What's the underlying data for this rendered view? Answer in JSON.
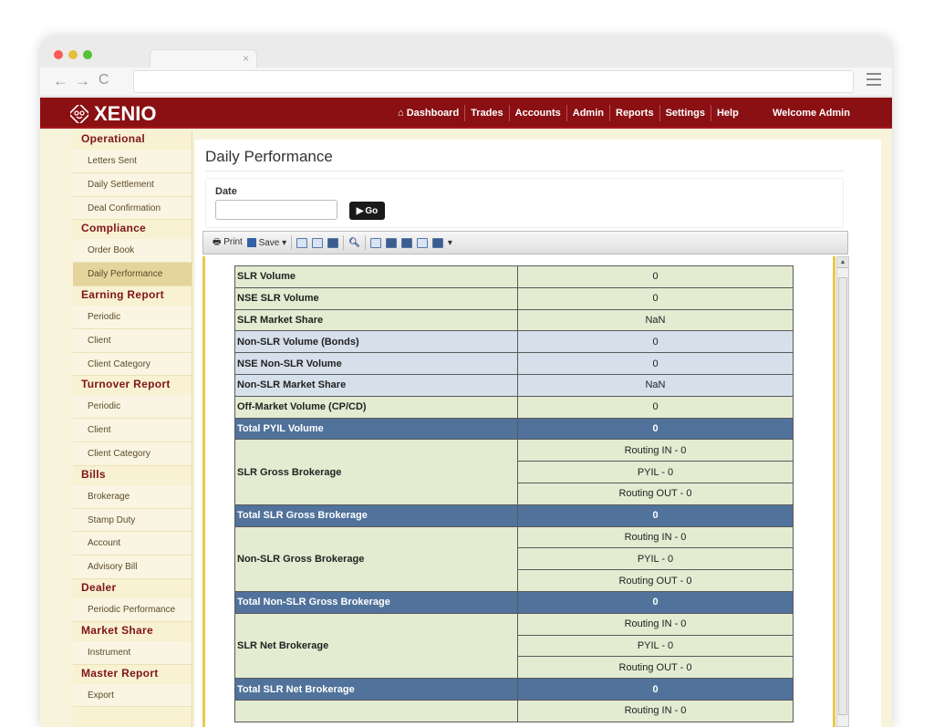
{
  "app": {
    "logo": "XENIO"
  },
  "nav": {
    "items": [
      "Dashboard",
      "Trades",
      "Accounts",
      "Admin",
      "Reports",
      "Settings",
      "Help"
    ],
    "welcome": "Welcome Admin"
  },
  "sidebar": [
    {
      "section": "Operational",
      "items": [
        "Letters Sent",
        "Daily Settlement",
        "Deal Confirmation"
      ]
    },
    {
      "section": "Compliance",
      "items": [
        "Order Book",
        "Daily Performance"
      ]
    },
    {
      "section": "Earning Report",
      "items": [
        "Periodic",
        "Client",
        "Client Category"
      ]
    },
    {
      "section": "Turnover Report",
      "items": [
        "Periodic",
        "Client",
        "Client Category"
      ]
    },
    {
      "section": "Bills",
      "items": [
        "Brokerage",
        "Stamp Duty",
        "Account",
        "Advisory Bill"
      ]
    },
    {
      "section": "Dealer",
      "items": [
        "Periodic Performance"
      ]
    },
    {
      "section": "Market Share",
      "items": [
        "Instrument"
      ]
    },
    {
      "section": "Master Report",
      "items": [
        "Export"
      ]
    }
  ],
  "active_item": "Daily Performance",
  "page": {
    "title": "Daily Performance"
  },
  "filter": {
    "date_label": "Date",
    "date_value": "",
    "go_label": "Go"
  },
  "report_toolbar": {
    "print": "Print",
    "save": "Save"
  },
  "report": {
    "rows": [
      {
        "label": "SLR Volume",
        "values": [
          "0"
        ],
        "style": "green"
      },
      {
        "label": "NSE SLR Volume",
        "values": [
          "0"
        ],
        "style": "green"
      },
      {
        "label": "SLR Market Share",
        "values": [
          "NaN"
        ],
        "style": "green"
      },
      {
        "label": "Non-SLR Volume (Bonds)",
        "values": [
          "0"
        ],
        "style": "blue"
      },
      {
        "label": "NSE Non-SLR Volume",
        "values": [
          "0"
        ],
        "style": "blue"
      },
      {
        "label": "Non-SLR Market Share",
        "values": [
          "NaN"
        ],
        "style": "blue"
      },
      {
        "label": "Off-Market Volume (CP/CD)",
        "values": [
          "0"
        ],
        "style": "green"
      },
      {
        "label": "Total PYIL Volume",
        "values": [
          "0"
        ],
        "style": "total"
      },
      {
        "label": "SLR Gross Brokerage",
        "values": [
          "Routing IN - 0",
          "PYIL - 0",
          "Routing OUT - 0"
        ],
        "style": "green"
      },
      {
        "label": "Total SLR Gross Brokerage",
        "values": [
          "0"
        ],
        "style": "total"
      },
      {
        "label": "Non-SLR Gross Brokerage",
        "values": [
          "Routing IN - 0",
          "PYIL - 0",
          "Routing OUT - 0"
        ],
        "style": "green"
      },
      {
        "label": "Total Non-SLR Gross Brokerage",
        "values": [
          "0"
        ],
        "style": "total"
      },
      {
        "label": "SLR Net Brokerage",
        "values": [
          "Routing IN - 0",
          "PYIL - 0",
          "Routing OUT - 0"
        ],
        "style": "green"
      },
      {
        "label": "Total SLR Net Brokerage",
        "values": [
          "0"
        ],
        "style": "total"
      },
      {
        "label": "",
        "values": [
          "Routing IN - 0"
        ],
        "style": "green"
      }
    ]
  }
}
